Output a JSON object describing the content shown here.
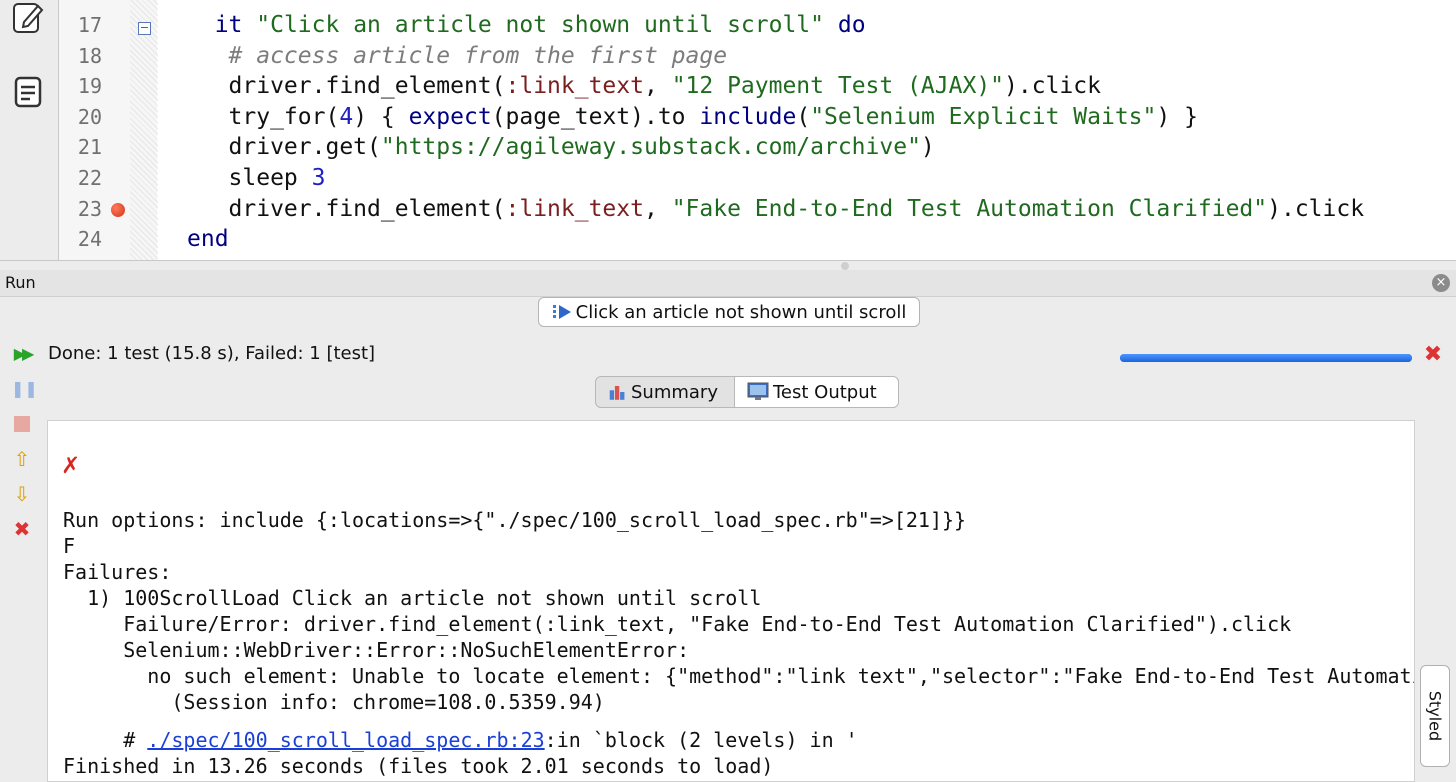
{
  "editor": {
    "lines": [
      {
        "num": "17",
        "tokens": [
          {
            "t": "it",
            "c": "kw"
          },
          {
            "t": " "
          },
          {
            "t": "\"Click an article not shown until scroll\"",
            "c": "str"
          },
          {
            "t": " "
          },
          {
            "t": "do",
            "c": "kw"
          }
        ],
        "indent": "  "
      },
      {
        "num": "18",
        "tokens": [
          {
            "t": "# access article from the first page",
            "c": "cmt"
          }
        ],
        "indent": "   "
      },
      {
        "num": "19",
        "tokens": [
          {
            "t": "driver.find_element("
          },
          {
            "t": ":link_text",
            "c": "sym"
          },
          {
            "t": ", "
          },
          {
            "t": "\"12 Payment Test (AJAX)\"",
            "c": "str"
          },
          {
            "t": ").click"
          }
        ],
        "indent": "   "
      },
      {
        "num": "20",
        "tokens": [
          {
            "t": "try_for("
          },
          {
            "t": "4",
            "c": "num"
          },
          {
            "t": ") { "
          },
          {
            "t": "expect",
            "c": "kw"
          },
          {
            "t": "(page_text).to "
          },
          {
            "t": "include",
            "c": "kw"
          },
          {
            "t": "("
          },
          {
            "t": "\"Selenium Explicit Waits\"",
            "c": "str"
          },
          {
            "t": ") }"
          }
        ],
        "indent": "   "
      },
      {
        "num": "21",
        "tokens": [
          {
            "t": "driver.get("
          },
          {
            "t": "\"https://agileway.substack.com/archive\"",
            "c": "str"
          },
          {
            "t": ")"
          }
        ],
        "indent": "   "
      },
      {
        "num": "22",
        "tokens": [
          {
            "t": "sleep "
          },
          {
            "t": "3",
            "c": "num"
          }
        ],
        "indent": "   "
      },
      {
        "num": "23",
        "tokens": [
          {
            "t": "driver.find_element("
          },
          {
            "t": ":link_text",
            "c": "sym"
          },
          {
            "t": ", "
          },
          {
            "t": "\"Fake End-to-End Test Automation Clarified\"",
            "c": "str"
          },
          {
            "t": ").click"
          }
        ],
        "indent": "   "
      },
      {
        "num": "24",
        "tokens": [
          {
            "t": "end",
            "c": "kw"
          }
        ],
        "indent": ""
      }
    ]
  },
  "run": {
    "panel_title": "Run",
    "tab_label": "Click an article not shown until scroll",
    "status": "Done: 1 test (15.8 s), Failed: 1 [test]",
    "progress_fraction": 1.0,
    "accent_color": "#1e6ee8",
    "view_tabs": {
      "summary": "Summary",
      "output": "Test Output"
    },
    "styled_label": "Styled",
    "sidebar_icons": [
      "rerun-icon",
      "pause-icon",
      "stop-icon",
      "previous-failure-icon",
      "next-failure-icon",
      "clear-icon"
    ],
    "fail_symbol": "✗",
    "output_lines": [
      "Run options: include {:locations=>{\"./spec/100_scroll_load_spec.rb\"=>[21]}}",
      "F",
      "Failures:",
      "  1) 100ScrollLoad Click an article not shown until scroll",
      "     Failure/Error: driver.find_element(:link_text, \"Fake End-to-End Test Automation Clarified\").click",
      "     Selenium::WebDriver::Error::NoSuchElementError:",
      "       no such element: Unable to locate element: {\"method\":\"link text\",\"selector\":\"Fake End-to-End Test Automation Clarified\"}",
      "         (Session info: chrome=108.0.5359.94)"
    ],
    "trace_prefix": "     # ",
    "trace_link": "./spec/100_scroll_load_spec.rb:23",
    "trace_suffix": ":in `block (2 levels) in '",
    "finished_line": "Finished in 13.26 seconds (files took 2.01 seconds to load)"
  }
}
